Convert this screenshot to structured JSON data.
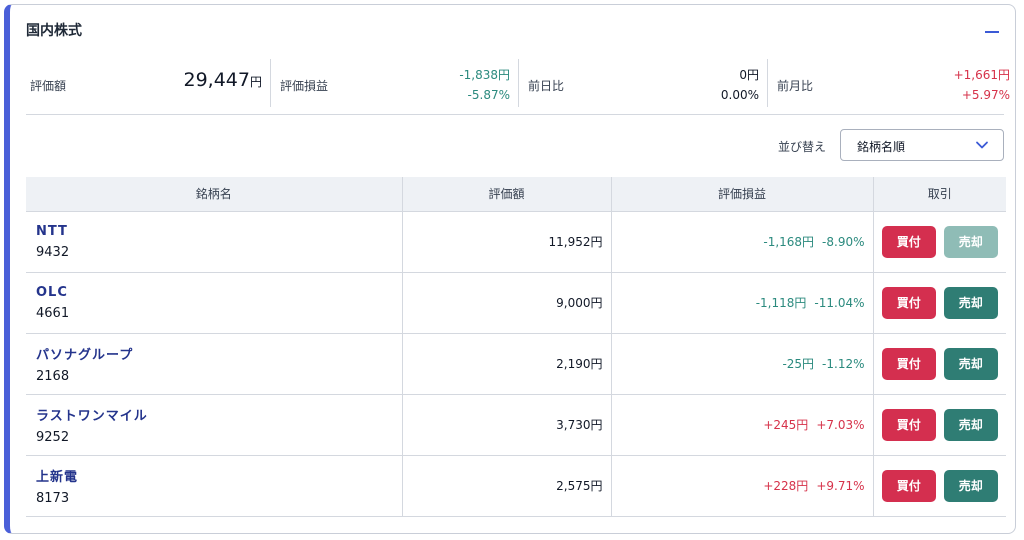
{
  "panel": {
    "title": "国内株式"
  },
  "summary": {
    "valuation": {
      "label": "評価額",
      "amount": "29,447",
      "unit": "円"
    },
    "profit_loss": {
      "label": "評価損益",
      "amount": "-1,838円",
      "percent": "-5.87%"
    },
    "day_change": {
      "label": "前日比",
      "amount": "0円",
      "percent": "0.00%"
    },
    "month_change": {
      "label": "前月比",
      "amount": "+1,661円",
      "percent": "+5.97%"
    }
  },
  "sort": {
    "label": "並び替え",
    "selected": "銘柄名順"
  },
  "table": {
    "headers": [
      "銘柄名",
      "評価額",
      "評価損益",
      "取引"
    ],
    "buy_label": "買付",
    "sell_label": "売却",
    "rows": [
      {
        "name": "NTT",
        "code": "9432",
        "value": "11,952円",
        "pl_amount": "-1,168円",
        "pl_percent": "-8.90%",
        "sell_disabled": true
      },
      {
        "name": "OLC",
        "code": "4661",
        "value": "9,000円",
        "pl_amount": "-1,118円",
        "pl_percent": "-11.04%",
        "sell_disabled": false
      },
      {
        "name": "パソナグループ",
        "code": "2168",
        "value": "2,190円",
        "pl_amount": "-25円",
        "pl_percent": "-1.12%",
        "sell_disabled": false
      },
      {
        "name": "ラストワンマイル",
        "code": "9252",
        "value": "3,730円",
        "pl_amount": "+245円",
        "pl_percent": "+7.03%",
        "sell_disabled": false
      },
      {
        "name": "上新電",
        "code": "8173",
        "value": "2,575円",
        "pl_amount": "+228円",
        "pl_percent": "+9.71%",
        "sell_disabled": false
      }
    ]
  },
  "colors": {
    "accent": "#4a5fd8",
    "negative": "#2b8a7e",
    "positive": "#d6324a",
    "buy": "#d42f4f",
    "sell": "#2f7d74",
    "sell_disabled": "#8fbcb6"
  }
}
